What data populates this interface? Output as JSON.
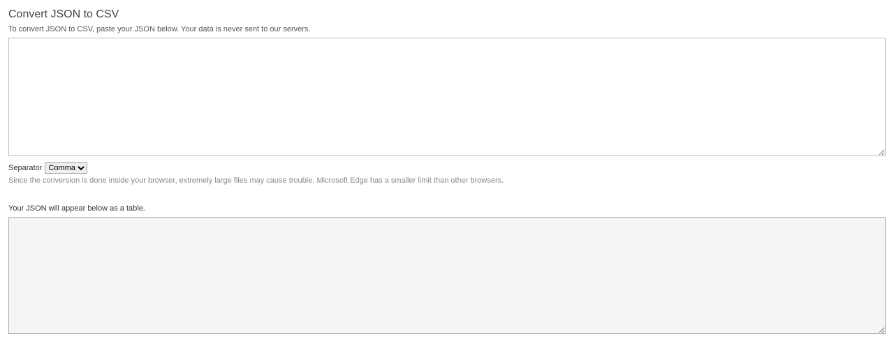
{
  "header": {
    "title": "Convert JSON to CSV",
    "subtitle": "To convert JSON to CSV, paste your JSON below. Your data is never sent to our servers."
  },
  "input": {
    "value": ""
  },
  "separator": {
    "label": "Separator",
    "options": [
      "Comma"
    ],
    "selected": "Comma"
  },
  "note": "Since the conversion is done inside your browser, extremely large files may cause trouble. Microsoft Edge has a smaller limit than other browsers.",
  "output": {
    "label": "Your JSON will appear below as a table.",
    "value": ""
  }
}
